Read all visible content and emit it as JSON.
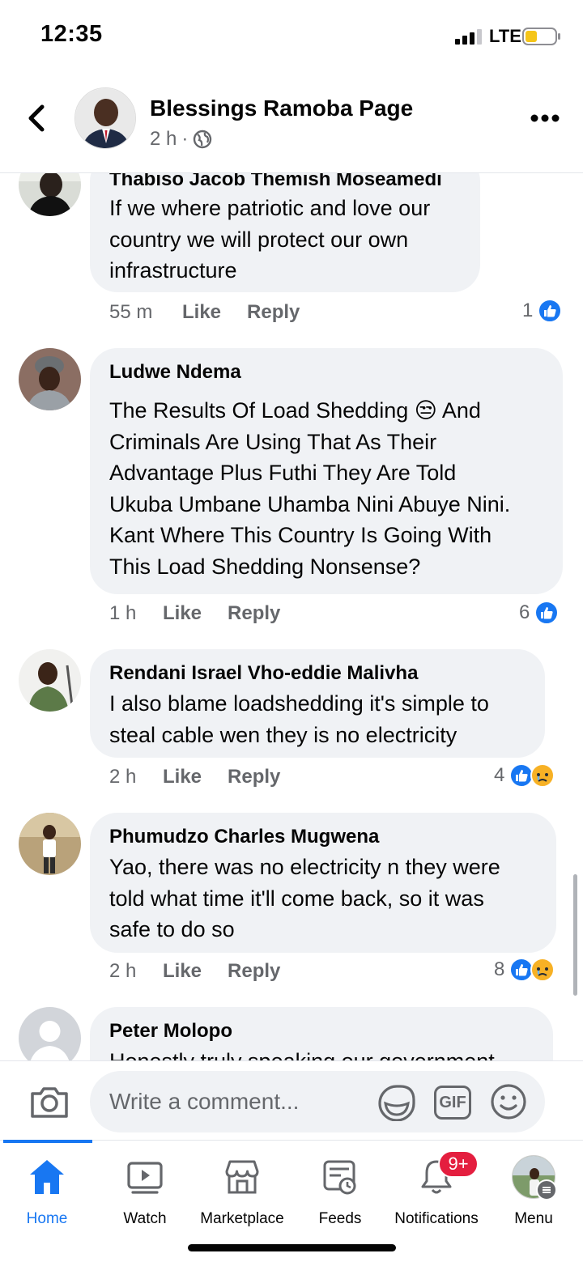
{
  "status_bar": {
    "time": "12:35",
    "network": "LTE"
  },
  "header": {
    "title": "Blessings Ramoba Page",
    "time": "2 h",
    "separator": "·",
    "privacy_icon": "globe-icon"
  },
  "comments": [
    {
      "author": "Thabiso Jacob Themish Moseamedi",
      "text": "If we where patriotic and love our\ncountry we will protect our own\ninfrastructure",
      "time": "55 m",
      "like_label": "Like",
      "reply_label": "Reply",
      "reaction_count": "1",
      "reactions": [
        "like"
      ]
    },
    {
      "author": "Ludwe Ndema",
      "text": "The Results Of Load Shedding 😒 And\nCriminals Are Using That As Their\nAdvantage Plus Futhi They Are Told\nUkuba Umbane Uhamba Nini Abuye Nini.\nKant Where This Country Is Going With\nThis Load Shedding Nonsense?",
      "time": "1 h",
      "like_label": "Like",
      "reply_label": "Reply",
      "reaction_count": "6",
      "reactions": [
        "like"
      ]
    },
    {
      "author": "Rendani Israel Vho-eddie Malivha",
      "text": "I also blame loadshedding it's simple to\nsteal cable wen they is no electricity",
      "time": "2 h",
      "like_label": "Like",
      "reply_label": "Reply",
      "reaction_count": "4",
      "reactions": [
        "like",
        "sad"
      ]
    },
    {
      "author": "Phumudzo Charles Mugwena",
      "text": "Yao, there was no electricity n they were\ntold what time it'll come back, so it was\nsafe to do so",
      "time": "2 h",
      "like_label": "Like",
      "reply_label": "Reply",
      "reaction_count": "8",
      "reactions": [
        "like",
        "sad"
      ]
    },
    {
      "author": "Peter Molopo",
      "text": "Honestly truly speaking our government"
    }
  ],
  "composer": {
    "placeholder": "Write a comment...",
    "gif_label": "GIF"
  },
  "tabs": [
    {
      "label": "Home",
      "icon": "home-icon",
      "active": true
    },
    {
      "label": "Watch",
      "icon": "watch-icon"
    },
    {
      "label": "Marketplace",
      "icon": "marketplace-icon"
    },
    {
      "label": "Feeds",
      "icon": "feeds-icon"
    },
    {
      "label": "Notifications",
      "icon": "bell-icon",
      "badge": "9+"
    },
    {
      "label": "Menu",
      "icon": "profile-avatar"
    }
  ],
  "colors": {
    "accent": "#1877f2",
    "bubble": "#f0f2f5",
    "secondary_text": "#65676b",
    "badge": "#e41e3f"
  }
}
